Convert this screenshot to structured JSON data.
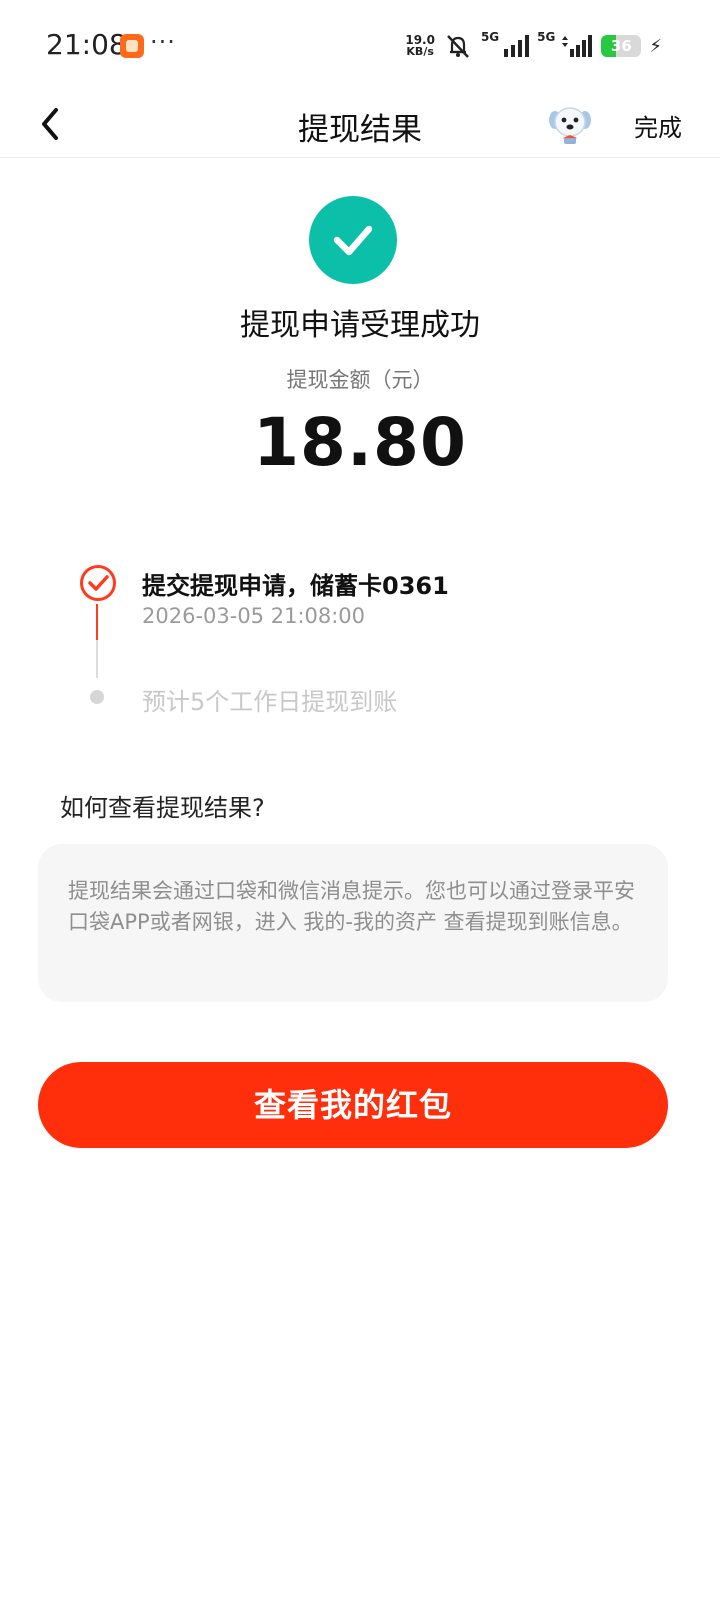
{
  "status_bar": {
    "time": "21:08",
    "more": "···",
    "net_speed_value": "19.0",
    "net_speed_unit": "KB/s",
    "signal1_label": "5G",
    "signal2_label": "5G",
    "battery_level": "36",
    "battery_fraction": 0.36,
    "battery_color": "#28c840"
  },
  "navbar": {
    "title": "提现结果",
    "done_label": "完成"
  },
  "result": {
    "title": "提现申请受理成功",
    "amount_label": "提现金额（元）",
    "amount": "18.80",
    "accent_color": "#0bbfa8"
  },
  "timeline": {
    "step1_text": "提交提现申请，储蓄卡0361",
    "step1_time": "2026-03-05 21:08:00",
    "step2_text": "预计5个工作日提现到账",
    "active_color": "#ff3b1f"
  },
  "help": {
    "title": "如何查看提现结果?",
    "text": "提现结果会通过口袋和微信消息提示。您也可以通过登录平安口袋APP或者网银，进入 我的-我的资产 查看提现到账信息。"
  },
  "cta": {
    "label": "查看我的红包",
    "color": "#ff2e0b"
  }
}
